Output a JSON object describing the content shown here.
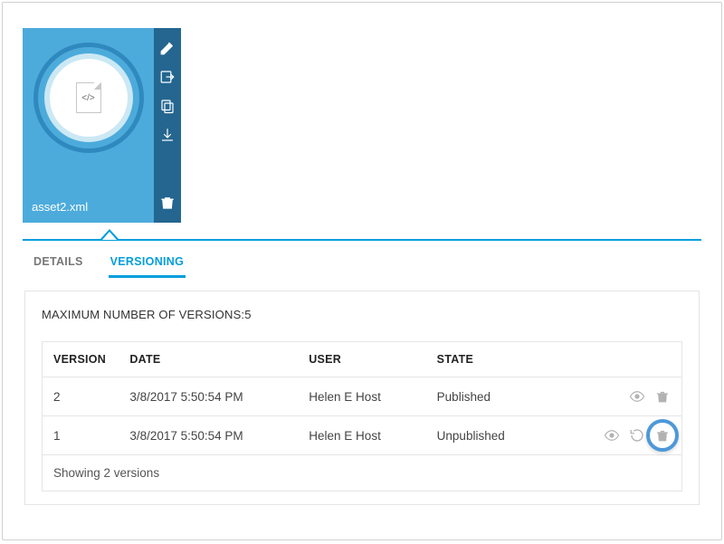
{
  "asset": {
    "name": "asset2.xml",
    "file_type_glyph": "</>",
    "actions": {
      "edit": "pencil-icon",
      "move": "export-icon",
      "copy": "copy-icon",
      "download": "download-icon",
      "delete": "trash-icon"
    }
  },
  "tabs": {
    "details": "DETAILS",
    "versioning": "VERSIONING",
    "active": "versioning"
  },
  "versioning": {
    "max_label": "MAXIMUM NUMBER OF VERSIONS:",
    "max_value": "5",
    "columns": {
      "version": "VERSION",
      "date": "DATE",
      "user": "USER",
      "state": "STATE"
    },
    "rows": [
      {
        "version": "2",
        "date": "3/8/2017 5:50:54 PM",
        "user": "Helen E Host",
        "state": "Published",
        "actions": [
          "view",
          "delete"
        ]
      },
      {
        "version": "1",
        "date": "3/8/2017 5:50:54 PM",
        "user": "Helen E Host",
        "state": "Unpublished",
        "actions": [
          "view",
          "restore",
          "delete"
        ],
        "highlight_delete": true
      }
    ],
    "footer": "Showing 2 versions"
  }
}
